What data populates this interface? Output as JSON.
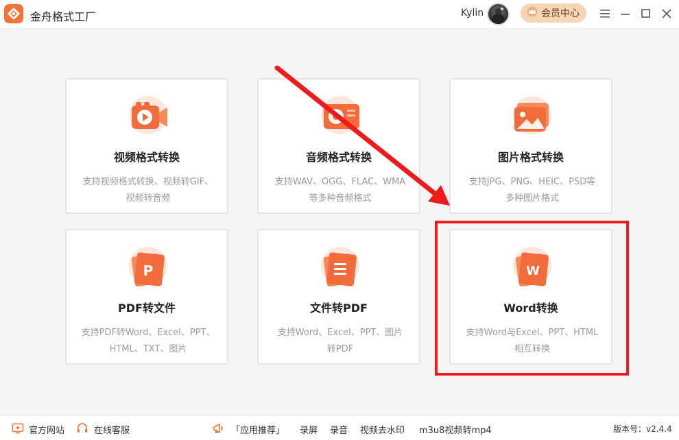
{
  "app": {
    "title": "金舟格式工厂",
    "username": "Kylin",
    "vip_label": "会员中心",
    "accent_color": "#f37436"
  },
  "cards": [
    {
      "title": "视频格式转换",
      "desc_line1": "支持视频格式转换、视频转GIF、",
      "desc_line2": "视频转音频",
      "icon": "video-camera-icon"
    },
    {
      "title": "音频格式转换",
      "desc_line1": "支持WAV、OGG、FLAC、WMA",
      "desc_line2": "等多种音频格式",
      "icon": "audio-icon"
    },
    {
      "title": "图片格式转换",
      "desc_line1": "支持JPG、PNG、HEIC、PSD等",
      "desc_line2": "多种图片格式",
      "icon": "image-icon"
    },
    {
      "title": "PDF转文件",
      "desc_line1": "支持PDF转Word、Excel、PPT、",
      "desc_line2": "HTML、TXT、图片",
      "icon": "pdf-p-icon"
    },
    {
      "title": "文件转PDF",
      "desc_line1": "支持Word、Excel、PPT、图片",
      "desc_line2": "转PDF",
      "icon": "document-icon"
    },
    {
      "title": "Word转换",
      "desc_line1": "支持Word与Excel、PPT、HTML",
      "desc_line2": "相互转换",
      "icon": "word-w-icon"
    }
  ],
  "bottombar": {
    "website": "官方网站",
    "support": "在线客服",
    "recommend": "「应用推荐」",
    "links": [
      "录屏",
      "录音",
      "视频去水印",
      "m3u8视频转mp4"
    ],
    "version": "版本号：v2.4.4"
  }
}
